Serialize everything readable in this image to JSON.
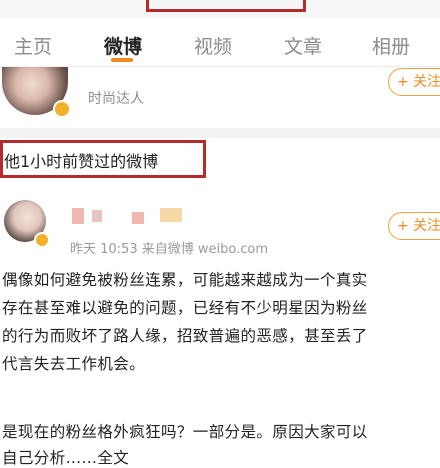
{
  "tabs": [
    {
      "label": "主页"
    },
    {
      "label": "微博"
    },
    {
      "label": "视频"
    },
    {
      "label": "文章"
    },
    {
      "label": "相册"
    }
  ],
  "user1": {
    "subtitle": "时尚达人",
    "follow_label": "+ 关注"
  },
  "section": {
    "title": "他1小时前赞过的微博"
  },
  "post": {
    "meta": "昨天 10:53  来自微博 weibo.com",
    "follow_label": "+ 关注",
    "lines": [
      "偶像如何避免被粉丝连累，可能越来越成为一个真实",
      "存在甚至难以避免的问题，已经有不少明星因为粉丝",
      "的行为而败坏了路人缘，招致普遍的恶感，甚至丢了",
      "代言失去工作机会。",
      "是现在的粉丝格外疯狂吗？一部分是。原因大家可以",
      "自己分析……全文"
    ]
  },
  "colors": {
    "accent": "#f08a1c",
    "highlight_box": "#b52a2a"
  }
}
